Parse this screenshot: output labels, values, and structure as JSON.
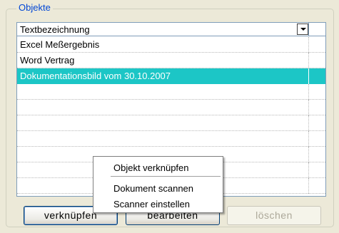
{
  "group": {
    "legend": "Objekte"
  },
  "list": {
    "header_label": "Textbezeichnung",
    "rows": [
      {
        "text": "Excel Meßergebnis"
      },
      {
        "text": "Word Vertrag"
      },
      {
        "text": "Dokumentationsbild vom 30.10.2007"
      },
      {
        "text": ""
      },
      {
        "text": ""
      },
      {
        "text": ""
      },
      {
        "text": ""
      },
      {
        "text": ""
      },
      {
        "text": ""
      },
      {
        "text": ""
      }
    ],
    "selected_index": 2,
    "selection_color": "#1cc6c6"
  },
  "buttons": {
    "link_label": "verknüpfen",
    "edit_label": "bearbeiten",
    "delete_label": "löschen"
  },
  "context_menu": {
    "items": [
      {
        "label": "Objekt verknüpfen"
      },
      {
        "label": "Dokument scannen"
      },
      {
        "label": "Scanner einstellen"
      }
    ]
  },
  "colors": {
    "legend": "#0046d5",
    "window_bg": "#ece9d8",
    "border": "#7f9db9"
  }
}
